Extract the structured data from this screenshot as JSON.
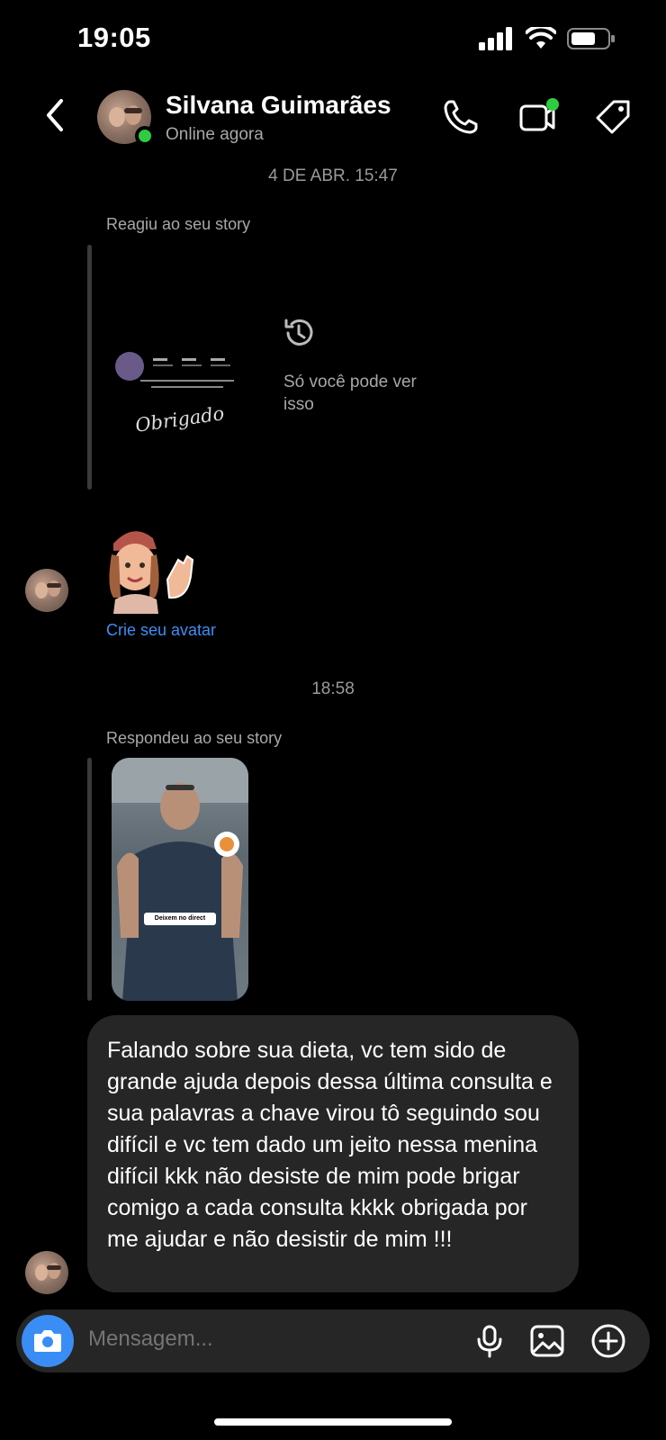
{
  "status_bar": {
    "time": "19:05"
  },
  "header": {
    "contact_name": "Silvana Guimarães",
    "contact_status": "Online agora"
  },
  "thread": {
    "timestamp_1": "4 DE ABR. 15:47",
    "reaction_label": "Reagiu ao seu story",
    "story_thumb_1_text": "Obrigado",
    "private_story_note": "Só você pode ver isso",
    "create_avatar_link": "Crie seu avatar",
    "timestamp_2": "18:58",
    "reply_label": "Respondeu ao seu story",
    "story_thumb_2_caption": "Deixem no direct",
    "message_text": "Falando sobre sua dieta, vc tem sido de grande ajuda depois dessa última consulta e sua palavras a chave virou tô seguindo sou difícil e vc tem dado um jeito nessa menina difícil kkk não desiste de mim pode brigar comigo a cada consulta kkkk obrigada por me ajudar e não desistir de mim !!!"
  },
  "composer": {
    "placeholder": "Mensagem..."
  },
  "colors": {
    "accent_blue": "#3a8df5",
    "online_green": "#2ecc40",
    "bubble_gray": "#262626"
  }
}
